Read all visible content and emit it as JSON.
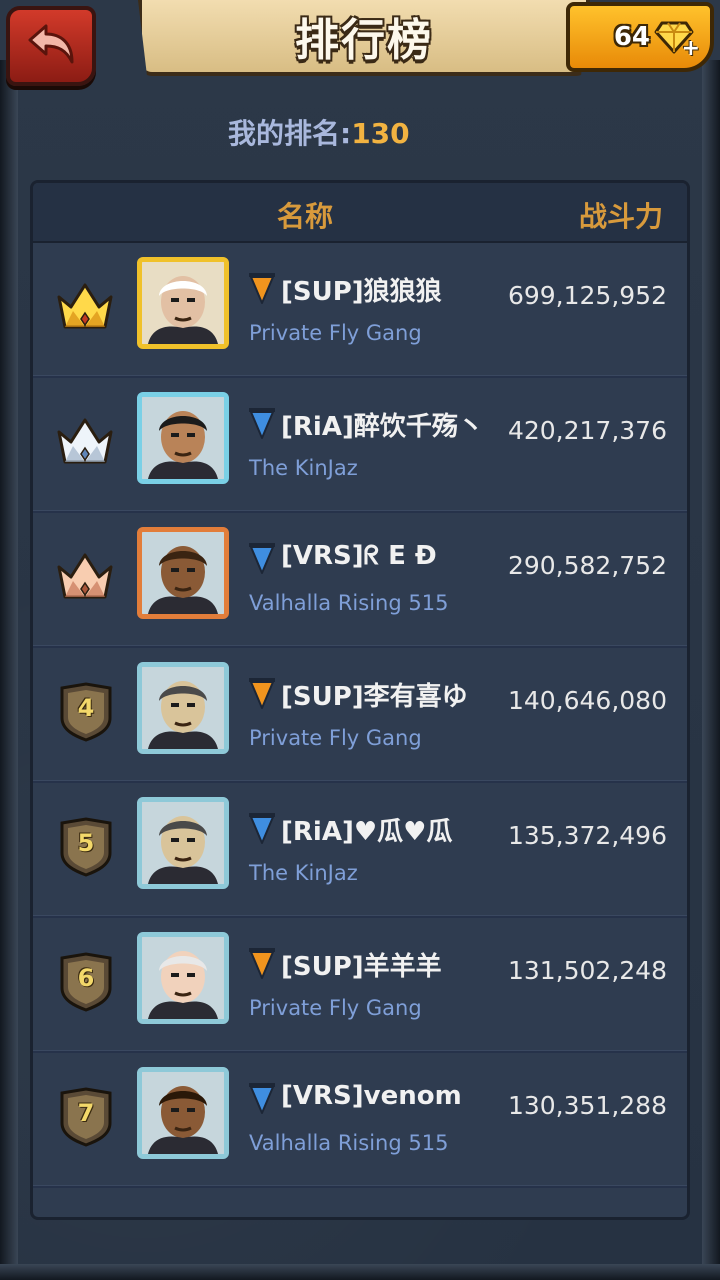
{
  "header": {
    "title": "排行榜",
    "gems": "64",
    "back_icon": "back-arrow-icon",
    "gem_icon": "diamond-icon"
  },
  "my_rank": {
    "label": "我的排名:",
    "value": "130"
  },
  "columns": {
    "name": "名称",
    "power": "战斗力"
  },
  "colors": {
    "accent": "#d89a3c",
    "guild": "#7f9fd8",
    "flag_orange": "#f0941e",
    "flag_blue": "#3f8ee0"
  },
  "rows": [
    {
      "rank": "1",
      "badge": "gold-crown-icon",
      "frame": "gold",
      "flag": "orange",
      "name": "[SUP]狼狼狼",
      "guild": "Private Fly Gang",
      "power": "699,125,952"
    },
    {
      "rank": "2",
      "badge": "silver-crown-icon",
      "frame": "silver",
      "flag": "blue",
      "name": "[RiA]醉饮千殇丶",
      "guild": "The KinJaz",
      "power": "420,217,376"
    },
    {
      "rank": "3",
      "badge": "bronze-crown-icon",
      "frame": "bronze",
      "flag": "blue",
      "name": "[VRS]ᖇ E Ð",
      "guild": "Valhalla Rising 515",
      "power": "290,582,752"
    },
    {
      "rank": "4",
      "badge": "rank-shield-icon",
      "frame": "normal",
      "flag": "orange",
      "name": "[SUP]李有喜ゆ",
      "guild": "Private Fly Gang",
      "power": "140,646,080"
    },
    {
      "rank": "5",
      "badge": "rank-shield-icon",
      "frame": "normal",
      "flag": "blue",
      "name": "[RiA]♥瓜♥瓜",
      "guild": "The KinJaz",
      "power": "135,372,496"
    },
    {
      "rank": "6",
      "badge": "rank-shield-icon",
      "frame": "normal",
      "flag": "orange",
      "name": "[SUP]羊羊羊",
      "guild": "Private Fly Gang",
      "power": "131,502,248"
    },
    {
      "rank": "7",
      "badge": "rank-shield-icon",
      "frame": "normal",
      "flag": "blue",
      "name": "[VRS]venom",
      "guild": "Valhalla Rising 515",
      "power": "130,351,288"
    }
  ]
}
